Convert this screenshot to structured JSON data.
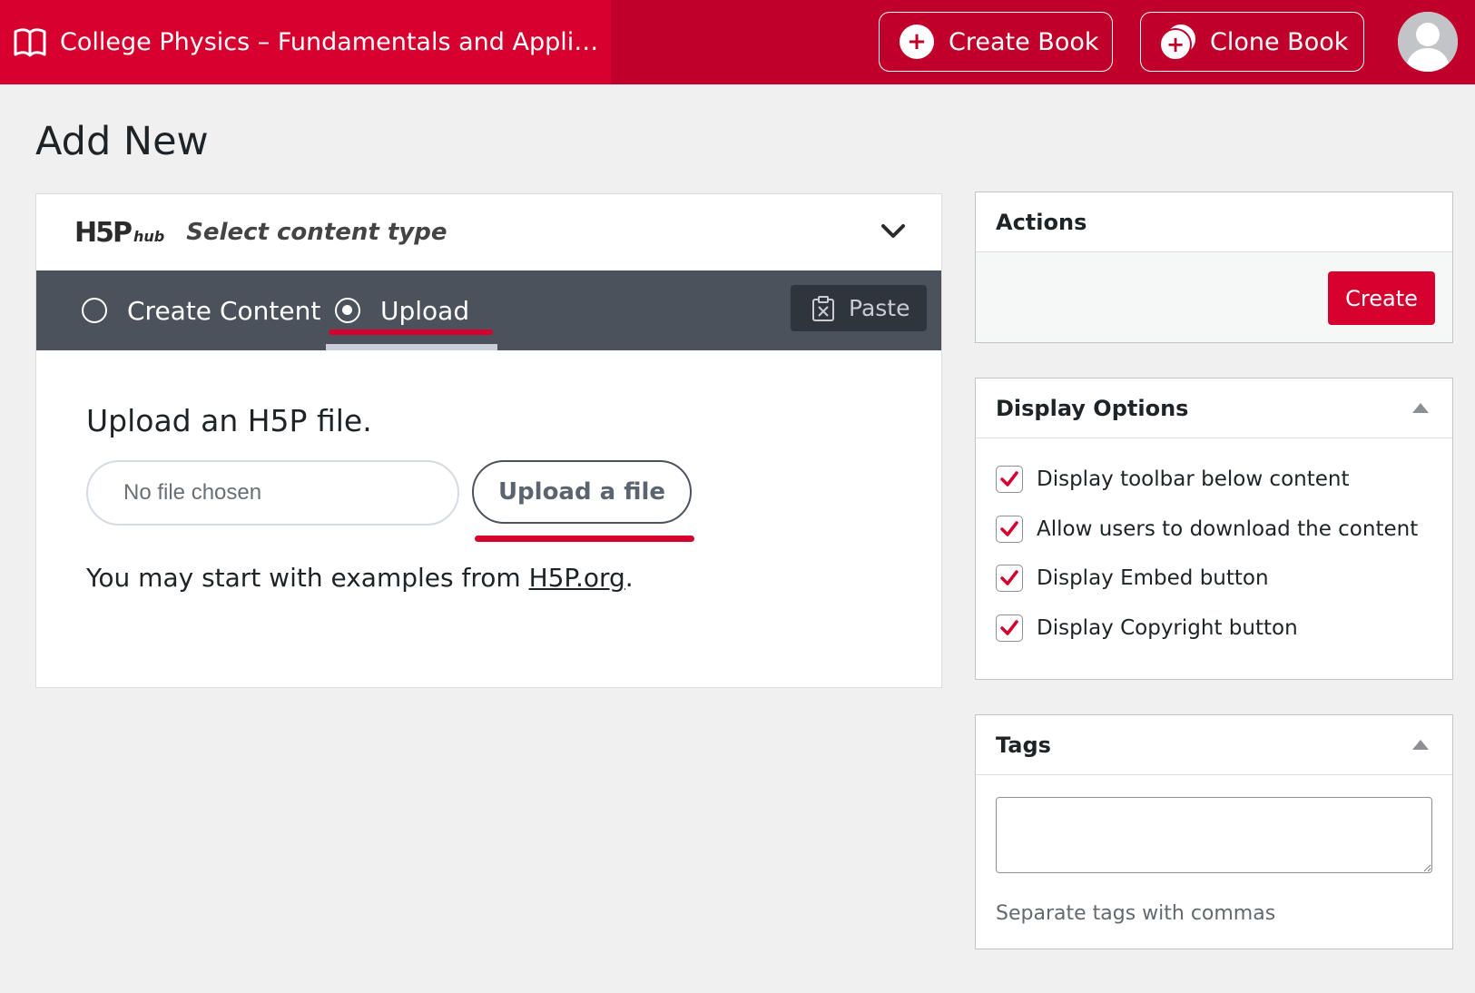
{
  "topbar": {
    "book_title": "College Physics – Fundamentals and Appli…",
    "create_book_label": "Create Book",
    "clone_book_label": "Clone Book",
    "accent_color": "#c0002a"
  },
  "page": {
    "title": "Add New"
  },
  "h5p": {
    "hub_logo_text": "H5P",
    "hub_logo_sub": "hub",
    "select_label": "Select content type",
    "tabs": [
      {
        "label": "Create Content",
        "selected": false
      },
      {
        "label": "Upload",
        "selected": true
      }
    ],
    "paste_label": "Paste",
    "upload_heading": "Upload an H5P file.",
    "file_placeholder": "No file chosen",
    "upload_button_label": "Upload a file",
    "examples_prefix": "You may start with examples from ",
    "examples_link": "H5P.org",
    "examples_suffix": "."
  },
  "actions": {
    "title": "Actions",
    "create_label": "Create"
  },
  "display_options": {
    "title": "Display Options",
    "items": [
      {
        "label": "Display toolbar below content",
        "checked": true
      },
      {
        "label": "Allow users to download the content",
        "checked": true
      },
      {
        "label": "Display Embed button",
        "checked": true
      },
      {
        "label": "Display Copyright button",
        "checked": true
      }
    ]
  },
  "tags": {
    "title": "Tags",
    "value": "",
    "hint": "Separate tags with commas"
  }
}
